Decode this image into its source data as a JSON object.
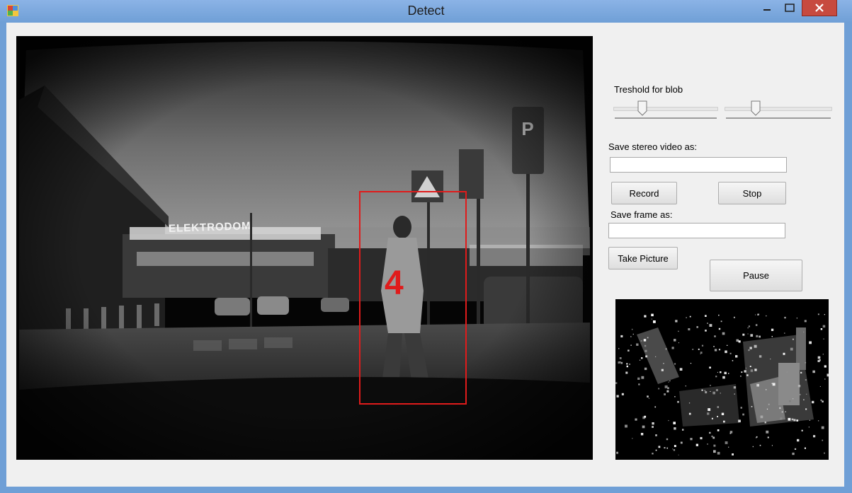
{
  "window": {
    "title": "Detect"
  },
  "camera": {
    "detection_label": "4",
    "sign_text": "ELEKTRODOM",
    "box_color": "#e01b1b"
  },
  "controls": {
    "threshold_label": "Treshold for blob",
    "slider1_value": 0.25,
    "slider2_value": 0.27,
    "save_video_label": "Save stereo video as:",
    "save_video_value": "",
    "record_button": "Record",
    "stop_button": "Stop",
    "save_frame_label": "Save frame as:",
    "save_frame_value": "",
    "take_picture_button": "Take Picture",
    "pause_button": "Pause"
  },
  "colors": {
    "title_bar": "#6f9fd6",
    "close_button": "#c74a3f",
    "detection_box": "#e01b1b"
  }
}
